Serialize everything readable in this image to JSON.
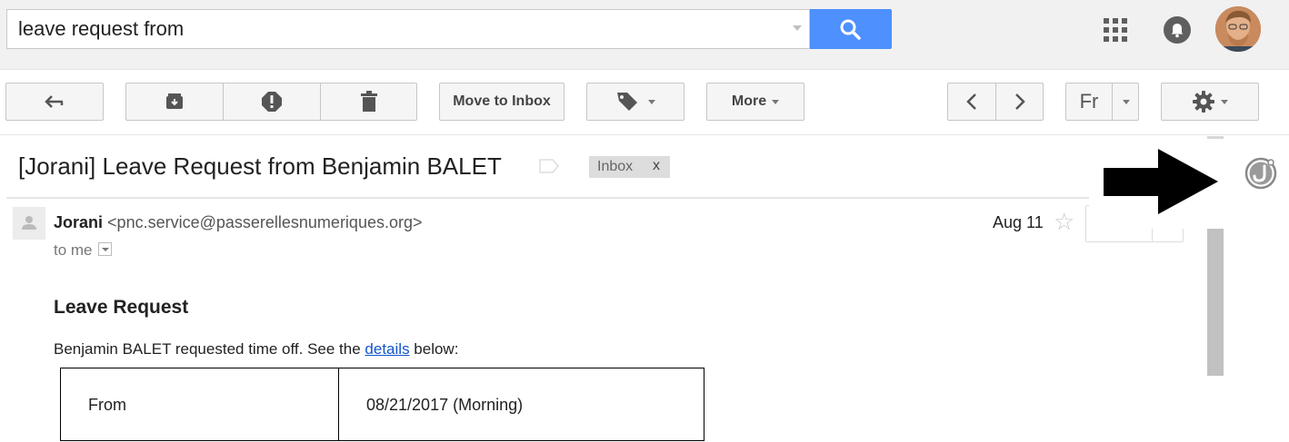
{
  "search": {
    "query": "leave request from"
  },
  "toolbar": {
    "move_to_inbox_label": "Move to Inbox",
    "more_label": "More",
    "language_label": "Fr"
  },
  "message": {
    "subject": "[Jorani] Leave Request from Benjamin BALET",
    "label_chip": {
      "text": "Inbox",
      "remove": "x"
    },
    "sender_name": "Jorani",
    "sender_email": "<pnc.service@passerellesnumeriques.org>",
    "to_text": "to me",
    "date": "Aug 11",
    "body": {
      "heading": "Leave Request",
      "intro_before": "Benjamin BALET requested time off. See the ",
      "intro_link": "details",
      "intro_after": " below:",
      "table": [
        {
          "label": "From",
          "value": "08/21/2017 (Morning)"
        }
      ]
    }
  },
  "colors": {
    "search_button": "#4d90fe",
    "link": "#1155cc",
    "header_bg": "#f1f1f1"
  },
  "icons": [
    "search-icon",
    "apps-grid-icon",
    "notifications-bell-icon",
    "back-arrow-icon",
    "archive-icon",
    "report-spam-icon",
    "delete-icon",
    "label-tag-icon",
    "chevron-left-icon",
    "chevron-right-icon",
    "gear-icon",
    "star-icon",
    "jorani-logo-icon"
  ]
}
